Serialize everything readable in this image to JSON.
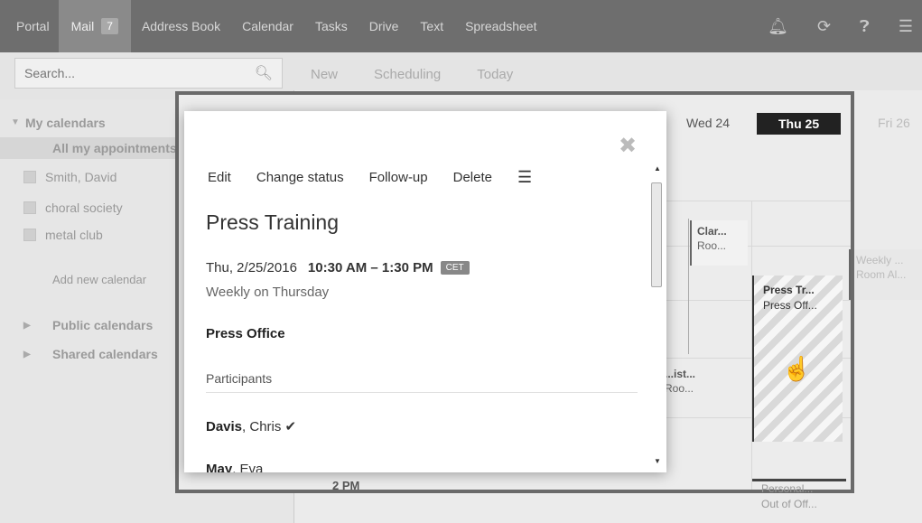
{
  "nav": {
    "items": [
      "Portal",
      "Mail",
      "Address Book",
      "Calendar",
      "Tasks",
      "Drive",
      "Text",
      "Spreadsheet"
    ],
    "mail_badge": "7",
    "icons": [
      "bell-icon",
      "refresh-icon",
      "help-icon",
      "menu-icon"
    ]
  },
  "search": {
    "placeholder": "Search..."
  },
  "toolbar": {
    "new": "New",
    "scheduling": "Scheduling",
    "today": "Today"
  },
  "sidebar": {
    "my_calendars": "My calendars",
    "all_appointments": "All my appointments",
    "calendars": [
      "Smith, David",
      "choral society",
      "metal club"
    ],
    "add_new": "Add new calendar",
    "public": "Public calendars",
    "shared": "Shared calendars"
  },
  "calendar": {
    "days": [
      "Wed 24",
      "Thu 25",
      "Fri 26"
    ],
    "time_label": "2 PM",
    "appointments": {
      "clar_title": "Clar...",
      "clar_room": "Roo...",
      "weekly_title": "Weekly ...",
      "weekly_room": "Room Al...",
      "ist_title": "...ist...",
      "ist_room": "Roo...",
      "press_title": "Press Tr...",
      "press_room": "Press Off...",
      "personal_title": "Personal...",
      "personal_sub": "Out of Off..."
    }
  },
  "popup": {
    "actions": [
      "Edit",
      "Change status",
      "Follow-up",
      "Delete"
    ],
    "title": "Press Training",
    "date": "Thu, 2/25/2016",
    "time": "10:30 AM – 1:30 PM",
    "timezone": "CET",
    "recurrence": "Weekly on Thursday",
    "location": "Press Office",
    "participants_label": "Participants",
    "participants": [
      {
        "last": "Davis",
        "first": ", Chris",
        "status": "✔"
      },
      {
        "last": "May",
        "first": ", Eva"
      }
    ]
  }
}
